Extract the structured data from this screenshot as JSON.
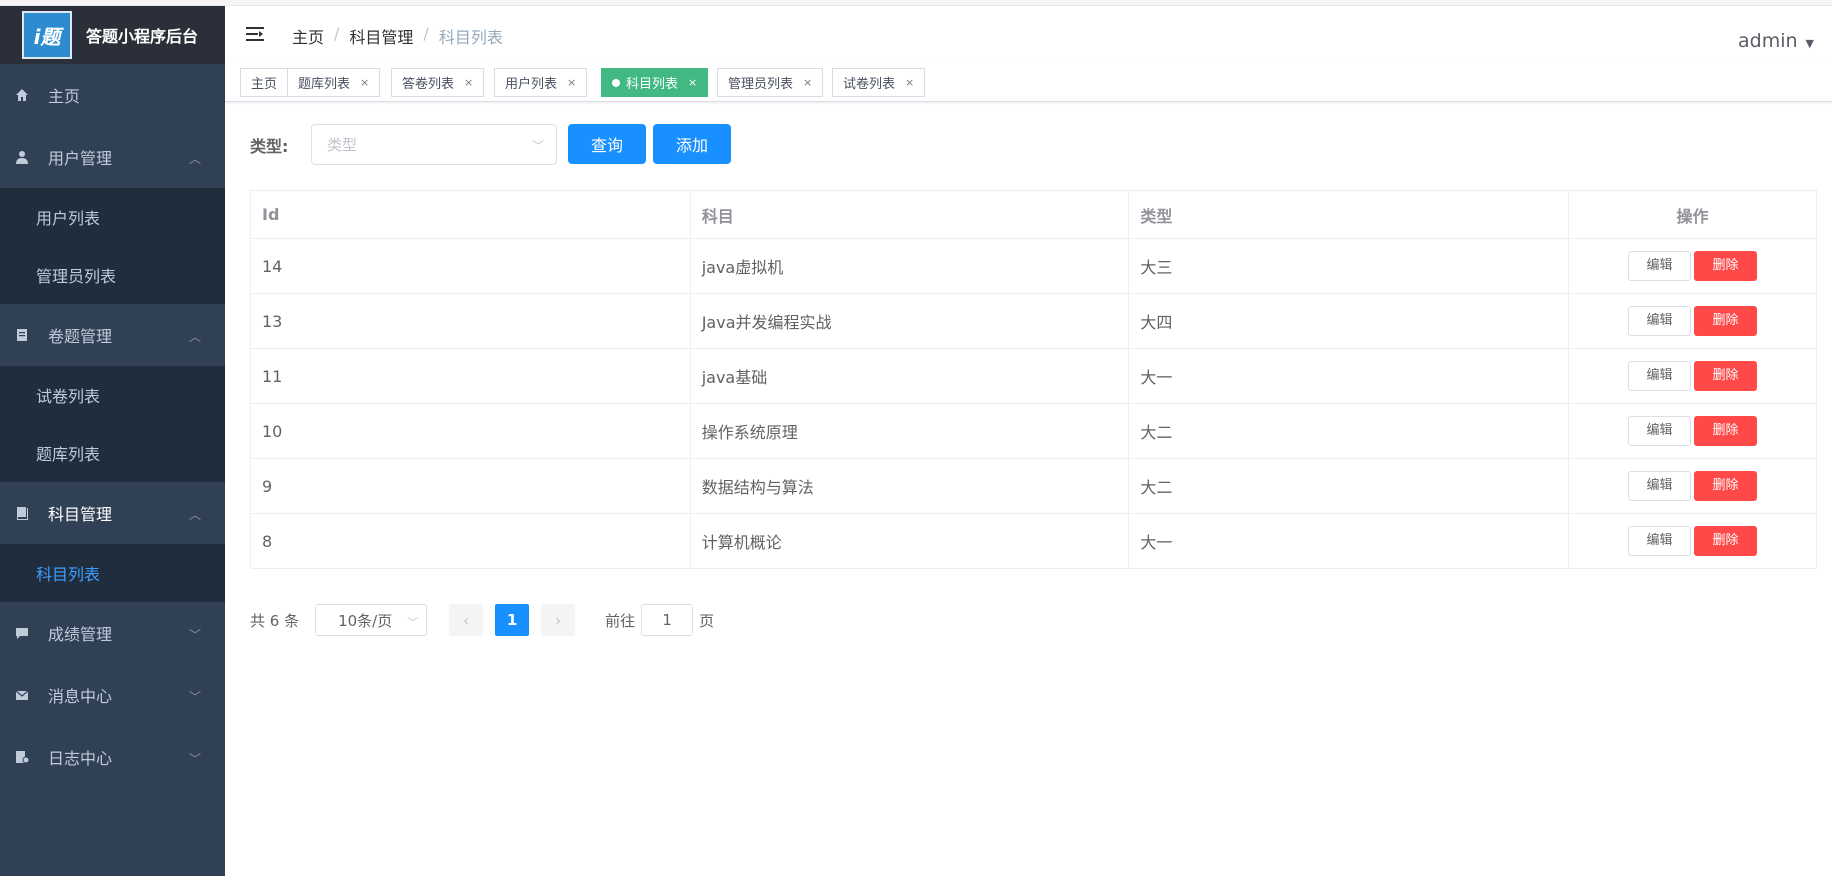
{
  "app": {
    "title": "答题小程序后台",
    "logo_glyph": "i题"
  },
  "sidebar": {
    "home": "主页",
    "groups": [
      {
        "label": "用户管理",
        "icon": "user-icon",
        "items": [
          "用户列表",
          "管理员列表"
        ]
      },
      {
        "label": "卷题管理",
        "icon": "document-icon",
        "items": [
          "试卷列表",
          "题库列表"
        ]
      },
      {
        "label": "科目管理",
        "icon": "book-icon",
        "items": [
          "科目列表"
        ]
      },
      {
        "label": "成绩管理",
        "icon": "chat-icon"
      },
      {
        "label": "消息中心",
        "icon": "mail-icon"
      },
      {
        "label": "日志中心",
        "icon": "log-icon"
      }
    ]
  },
  "header": {
    "breadcrumb": [
      "主页",
      "科目管理",
      "科目列表"
    ],
    "breadcrumb_sep": "/",
    "user": "admin"
  },
  "tags": [
    "主页",
    "题库列表",
    "答卷列表",
    "用户列表",
    "科目列表",
    "管理员列表",
    "试卷列表"
  ],
  "tag_close": "×",
  "filter": {
    "label": "类型:",
    "placeholder": "类型",
    "query_button": "查询",
    "add_button": "添加"
  },
  "table": {
    "columns": [
      "Id",
      "科目",
      "类型",
      "操作"
    ],
    "rows": [
      {
        "id": "14",
        "subject": "java虚拟机",
        "type": "大三"
      },
      {
        "id": "13",
        "subject": "Java并发编程实战",
        "type": "大四"
      },
      {
        "id": "11",
        "subject": "java基础",
        "type": "大一"
      },
      {
        "id": "10",
        "subject": "操作系统原理",
        "type": "大二"
      },
      {
        "id": "9",
        "subject": "数据结构与算法",
        "type": "大二"
      },
      {
        "id": "8",
        "subject": "计算机概论",
        "type": "大一"
      }
    ],
    "edit_label": "编辑",
    "delete_label": "删除"
  },
  "pagination": {
    "total": "共 6 条",
    "page_size": "10条/页",
    "current_page": "1",
    "goto_prefix": "前往",
    "goto_value": "1",
    "goto_suffix": "页"
  },
  "colors": {
    "sidebar_bg": "#304156",
    "active_tag": "#42b983",
    "primary": "#1890ff",
    "danger": "#ff4949",
    "submenu_active": "#409eff"
  }
}
